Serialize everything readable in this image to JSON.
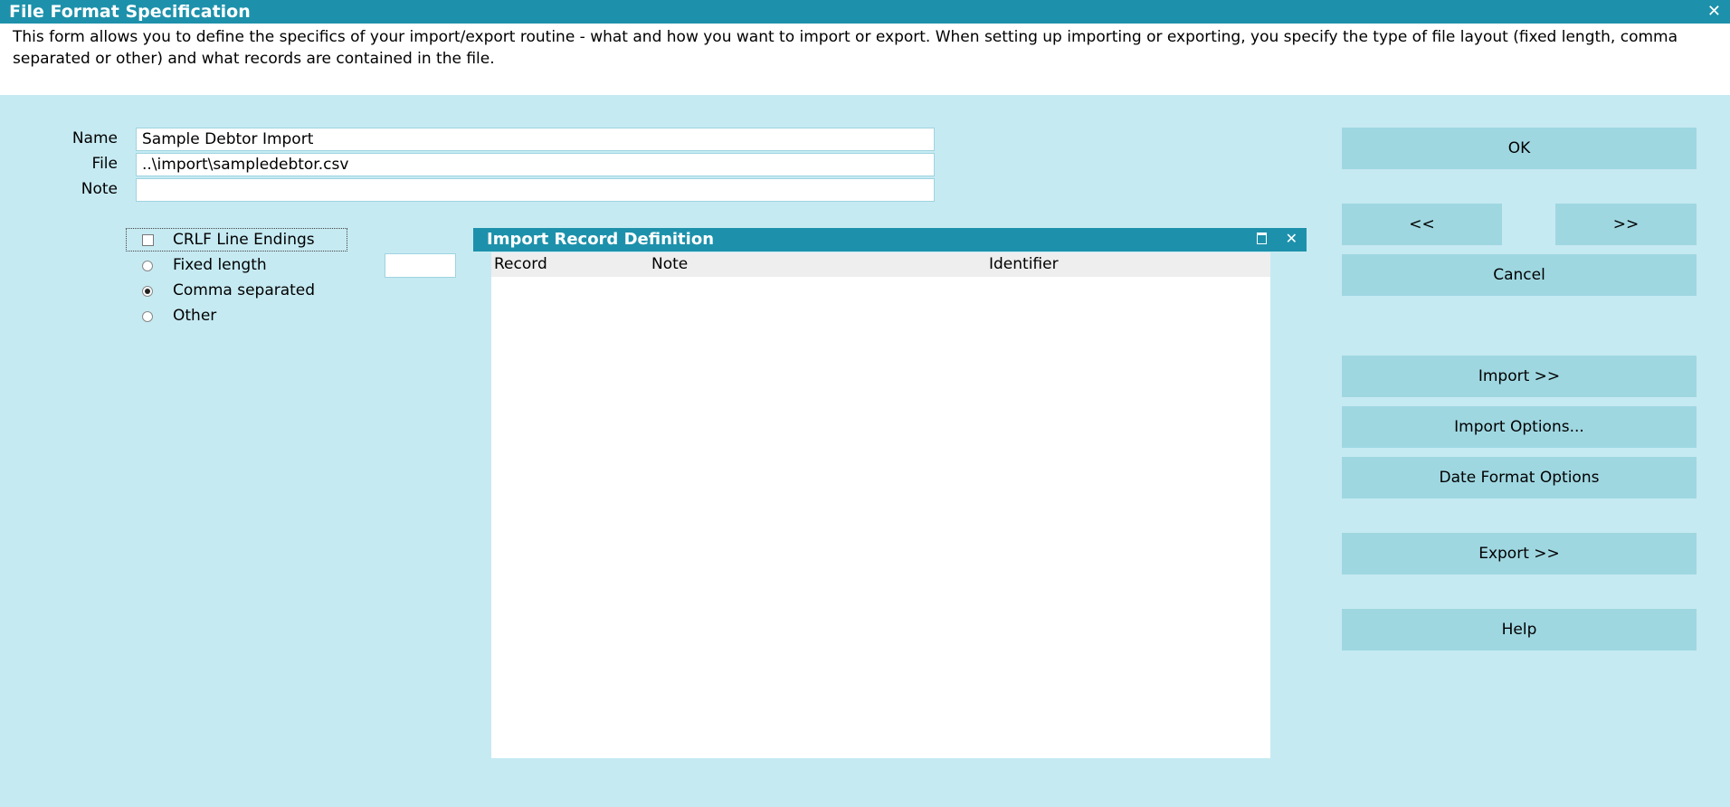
{
  "window": {
    "title": "File Format Specification"
  },
  "description": "This form allows you to define the specifics of your import/export routine - what and how you want to import or export. When setting up importing or exporting, you specify the type of file layout (fixed length, comma separated or other) and what records are contained in the file.",
  "form": {
    "name_label": "Name",
    "name_value": "Sample Debtor Import",
    "file_label": "File",
    "file_value": "..\\import\\sampledebtor.csv",
    "note_label": "Note",
    "note_value": ""
  },
  "options": {
    "crlf_label": "CRLF Line Endings",
    "crlf_checked": false,
    "fixed_label": "Fixed length",
    "fixed_length_value": "",
    "comma_label": "Comma separated",
    "other_label": "Other",
    "selected": "Comma separated"
  },
  "panel": {
    "title": "Import Record Definition",
    "columns": [
      "Record",
      "Note",
      "Identifier"
    ],
    "rows": []
  },
  "buttons": {
    "ok": "OK",
    "prev": "<<",
    "next": ">>",
    "cancel": "Cancel",
    "import": "Import  >>",
    "import_options": "Import Options...",
    "date_format": "Date Format Options",
    "export": "Export  >>",
    "help": "Help"
  },
  "icons": {
    "close": "close-icon",
    "maximize": "maximize-icon"
  },
  "colors": {
    "titlebar": "#1d91ab",
    "background": "#c6eaf2",
    "button": "#9fd7e1"
  }
}
